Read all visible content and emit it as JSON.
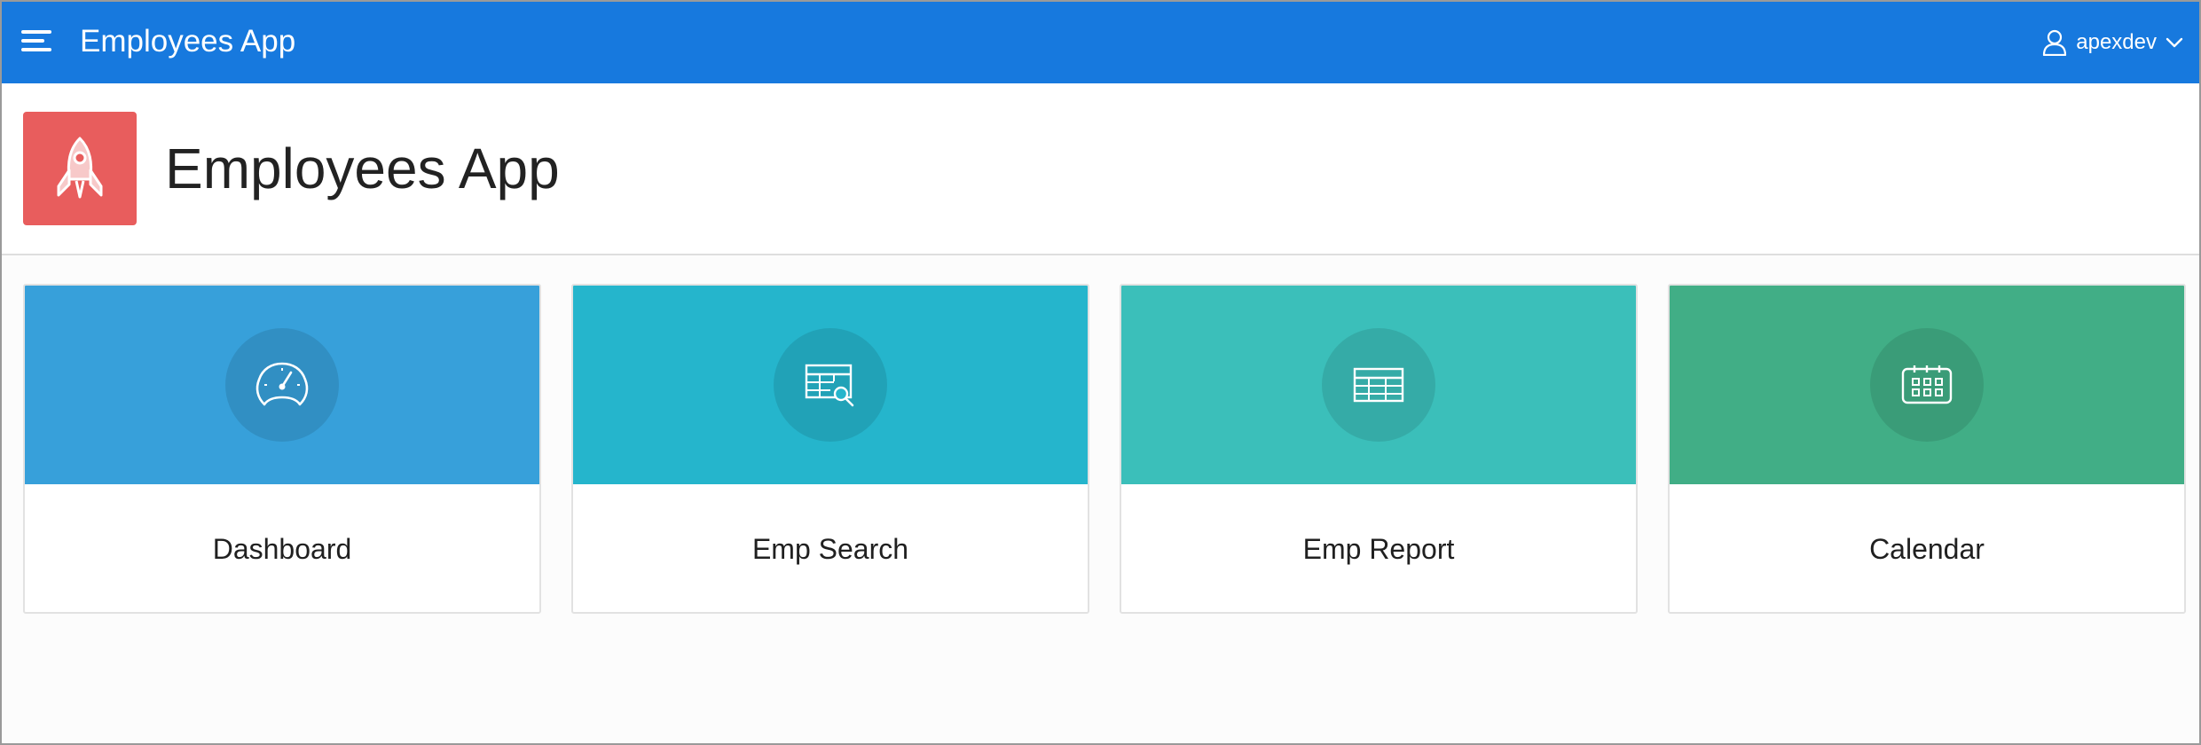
{
  "header": {
    "app_title": "Employees App",
    "user": "apexdev",
    "bar_color": "#1779de",
    "menu_icon": "hamburger-icon",
    "user_icon": "user-icon",
    "dropdown_icon": "chevron-down-icon"
  },
  "page": {
    "title": "Employees App",
    "app_icon": "rocket-icon",
    "app_icon_color": "#e85d5d"
  },
  "cards": [
    {
      "label": "Dashboard",
      "icon": "dashboard-gauge-icon",
      "color": "#37a0da"
    },
    {
      "label": "Emp Search",
      "icon": "table-search-icon",
      "color": "#25b5cc"
    },
    {
      "label": "Emp Report",
      "icon": "table-icon",
      "color": "#3bbfba"
    },
    {
      "label": "Calendar",
      "icon": "calendar-icon",
      "color": "#41ae86"
    }
  ]
}
